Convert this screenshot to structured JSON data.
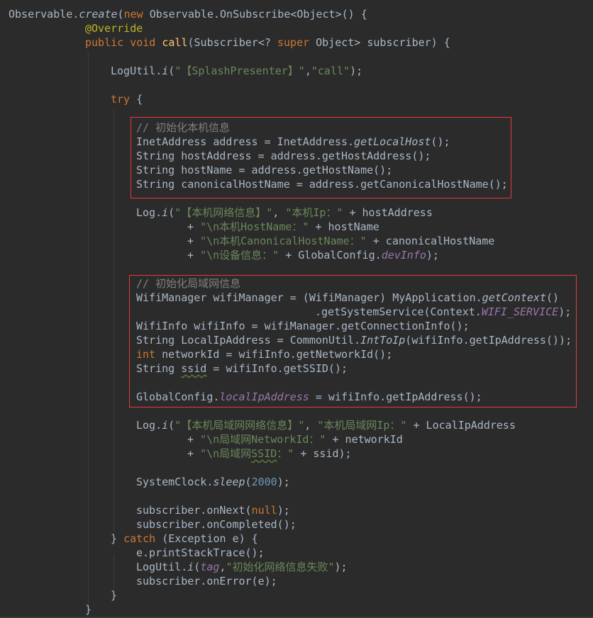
{
  "editor": {
    "lines": [
      {
        "indent": 12,
        "tokens": [
          {
            "t": "plain",
            "v": "Observable."
          },
          {
            "t": "static",
            "v": "create"
          },
          {
            "t": "plain",
            "v": "("
          },
          {
            "t": "kw",
            "v": "new "
          },
          {
            "t": "plain",
            "v": "Observable.OnSubscribe<Object>() {"
          }
        ]
      },
      {
        "indent": 120,
        "tokens": [
          {
            "t": "ann",
            "v": "@Override"
          }
        ]
      },
      {
        "indent": 120,
        "tokens": [
          {
            "t": "kw",
            "v": "public void "
          },
          {
            "t": "func",
            "v": "call"
          },
          {
            "t": "plain",
            "v": "(Subscriber<? "
          },
          {
            "t": "kw",
            "v": "super "
          },
          {
            "t": "plain",
            "v": "Object> subscriber) {"
          }
        ]
      },
      {
        "indent": 0,
        "tokens": []
      },
      {
        "indent": 156,
        "tokens": [
          {
            "t": "plain",
            "v": "LogUtil."
          },
          {
            "t": "static",
            "v": "i"
          },
          {
            "t": "plain",
            "v": "("
          },
          {
            "t": "str",
            "v": "\"【SplashPresenter】\""
          },
          {
            "t": "plain",
            "v": ","
          },
          {
            "t": "str",
            "v": "\"call\""
          },
          {
            "t": "plain",
            "v": ");"
          }
        ]
      },
      {
        "indent": 0,
        "tokens": []
      },
      {
        "indent": 156,
        "tokens": [
          {
            "t": "kw",
            "v": "try "
          },
          {
            "t": "plain",
            "v": "{"
          }
        ]
      },
      {
        "indent": 0,
        "tokens": []
      },
      {
        "indent": 192,
        "tokens": [
          {
            "t": "comment",
            "v": "// 初始化本机信息"
          }
        ]
      },
      {
        "indent": 192,
        "tokens": [
          {
            "t": "plain",
            "v": "InetAddress address = InetAddress."
          },
          {
            "t": "static",
            "v": "getLocalHost"
          },
          {
            "t": "plain",
            "v": "();"
          }
        ]
      },
      {
        "indent": 192,
        "tokens": [
          {
            "t": "plain",
            "v": "String hostAddress = address.getHostAddress();"
          }
        ]
      },
      {
        "indent": 192,
        "tokens": [
          {
            "t": "plain",
            "v": "String hostName = address.getHostName();"
          }
        ]
      },
      {
        "indent": 192,
        "tokens": [
          {
            "t": "plain",
            "v": "String canonicalHostName = address.getCanonicalHostName();"
          }
        ]
      },
      {
        "indent": 0,
        "tokens": []
      },
      {
        "indent": 192,
        "tokens": [
          {
            "t": "plain",
            "v": "Log."
          },
          {
            "t": "static",
            "v": "i"
          },
          {
            "t": "plain",
            "v": "("
          },
          {
            "t": "str",
            "v": "\"【本机网络信息】\""
          },
          {
            "t": "plain",
            "v": ", "
          },
          {
            "t": "str",
            "v": "\"本机Ip：\""
          },
          {
            "t": "plain",
            "v": " + hostAddress"
          }
        ]
      },
      {
        "indent": 264,
        "tokens": [
          {
            "t": "plain",
            "v": "+ "
          },
          {
            "t": "str",
            "v": "\"\\n本机HostName：\""
          },
          {
            "t": "plain",
            "v": " + hostName"
          }
        ]
      },
      {
        "indent": 264,
        "tokens": [
          {
            "t": "plain",
            "v": "+ "
          },
          {
            "t": "str",
            "v": "\"\\n本机CanonicalHostName：\""
          },
          {
            "t": "plain",
            "v": " + canonicalHostName"
          }
        ]
      },
      {
        "indent": 264,
        "tokens": [
          {
            "t": "plain",
            "v": "+ "
          },
          {
            "t": "str",
            "v": "\"\\n设备信息：\""
          },
          {
            "t": "plain",
            "v": " + GlobalConfig."
          },
          {
            "t": "field",
            "v": "devInfo"
          },
          {
            "t": "plain",
            "v": ");"
          }
        ]
      },
      {
        "indent": 0,
        "tokens": []
      },
      {
        "indent": 192,
        "tokens": [
          {
            "t": "comment",
            "v": "// 初始化局域网信息"
          }
        ]
      },
      {
        "indent": 192,
        "tokens": [
          {
            "t": "plain",
            "v": "WifiManager wifiManager = (WifiManager) MyApplication."
          },
          {
            "t": "static",
            "v": "getContext"
          },
          {
            "t": "plain",
            "v": "()"
          }
        ]
      },
      {
        "indent": 444,
        "tokens": [
          {
            "t": "plain",
            "v": ".getSystemService(Context."
          },
          {
            "t": "field",
            "v": "WIFI_SERVICE"
          },
          {
            "t": "plain",
            "v": ");"
          }
        ]
      },
      {
        "indent": 192,
        "tokens": [
          {
            "t": "plain",
            "v": "WifiInfo wifiInfo = wifiManager.getConnectionInfo();"
          }
        ]
      },
      {
        "indent": 192,
        "tokens": [
          {
            "t": "plain",
            "v": "String LocalIpAddress = CommonUtil."
          },
          {
            "t": "static",
            "v": "IntToIp"
          },
          {
            "t": "plain",
            "v": "(wifiInfo.getIpAddress());"
          }
        ]
      },
      {
        "indent": 192,
        "tokens": [
          {
            "t": "kw",
            "v": "int "
          },
          {
            "t": "plain",
            "v": "networkId = wifiInfo.getNetworkId();"
          }
        ]
      },
      {
        "indent": 192,
        "tokens": [
          {
            "t": "plain",
            "v": "String "
          },
          {
            "t": "warn",
            "v": "ssid"
          },
          {
            "t": "plain",
            "v": " = wifiInfo.getSSID();"
          }
        ]
      },
      {
        "indent": 0,
        "tokens": []
      },
      {
        "indent": 192,
        "tokens": [
          {
            "t": "plain",
            "v": "GlobalConfig."
          },
          {
            "t": "field",
            "v": "localIpAddress"
          },
          {
            "t": "plain",
            "v": " = wifiInfo.getIpAddress();"
          }
        ]
      },
      {
        "indent": 0,
        "tokens": []
      },
      {
        "indent": 192,
        "tokens": [
          {
            "t": "plain",
            "v": "Log."
          },
          {
            "t": "static",
            "v": "i"
          },
          {
            "t": "plain",
            "v": "("
          },
          {
            "t": "str",
            "v": "\"【本机局域网网络信息】\""
          },
          {
            "t": "plain",
            "v": ", "
          },
          {
            "t": "str",
            "v": "\"本机局域网Ip：\""
          },
          {
            "t": "plain",
            "v": " + LocalIpAddress"
          }
        ]
      },
      {
        "indent": 264,
        "tokens": [
          {
            "t": "plain",
            "v": "+ "
          },
          {
            "t": "str",
            "v": "\"\\n局域网NetworkId：\""
          },
          {
            "t": "plain",
            "v": " + networkId"
          }
        ]
      },
      {
        "indent": 264,
        "tokens": [
          {
            "t": "plain",
            "v": "+ "
          },
          {
            "t": "str",
            "v": "\"\\n局域网"
          },
          {
            "t": "strwarn",
            "v": "SSID"
          },
          {
            "t": "str",
            "v": "：\""
          },
          {
            "t": "plain",
            "v": " + ssid);"
          }
        ]
      },
      {
        "indent": 0,
        "tokens": []
      },
      {
        "indent": 192,
        "tokens": [
          {
            "t": "plain",
            "v": "SystemClock."
          },
          {
            "t": "static",
            "v": "sleep"
          },
          {
            "t": "plain",
            "v": "("
          },
          {
            "t": "num",
            "v": "2000"
          },
          {
            "t": "plain",
            "v": ");"
          }
        ]
      },
      {
        "indent": 0,
        "tokens": []
      },
      {
        "indent": 192,
        "tokens": [
          {
            "t": "plain",
            "v": "subscriber.onNext("
          },
          {
            "t": "kw",
            "v": "null"
          },
          {
            "t": "plain",
            "v": ");"
          }
        ]
      },
      {
        "indent": 192,
        "tokens": [
          {
            "t": "plain",
            "v": "subscriber.onCompleted();"
          }
        ]
      },
      {
        "indent": 156,
        "tokens": [
          {
            "t": "plain",
            "v": "} "
          },
          {
            "t": "kw",
            "v": "catch "
          },
          {
            "t": "plain",
            "v": "(Exception e) {"
          }
        ]
      },
      {
        "indent": 192,
        "tokens": [
          {
            "t": "plain",
            "v": "e.printStackTrace();"
          }
        ]
      },
      {
        "indent": 192,
        "tokens": [
          {
            "t": "plain",
            "v": "LogUtil."
          },
          {
            "t": "static",
            "v": "i"
          },
          {
            "t": "plain",
            "v": "("
          },
          {
            "t": "field",
            "v": "tag"
          },
          {
            "t": "plain",
            "v": ","
          },
          {
            "t": "str",
            "v": "\"初始化网络信息失败\""
          },
          {
            "t": "plain",
            "v": ");"
          }
        ]
      },
      {
        "indent": 192,
        "tokens": [
          {
            "t": "plain",
            "v": "subscriber.onError(e);"
          }
        ]
      },
      {
        "indent": 156,
        "tokens": [
          {
            "t": "plain",
            "v": "}"
          }
        ]
      },
      {
        "indent": 120,
        "tokens": [
          {
            "t": "plain",
            "v": "}"
          }
        ]
      }
    ]
  },
  "colors": {
    "background": "#2b2b2b",
    "plain": "#a9b7c6",
    "keyword": "#cc7832",
    "string": "#6a8759",
    "annotation": "#bbb529",
    "number": "#6897bb",
    "function": "#ffc66d",
    "field": "#9876aa",
    "comment": "#808080",
    "highlight_box": "#e8383a"
  }
}
